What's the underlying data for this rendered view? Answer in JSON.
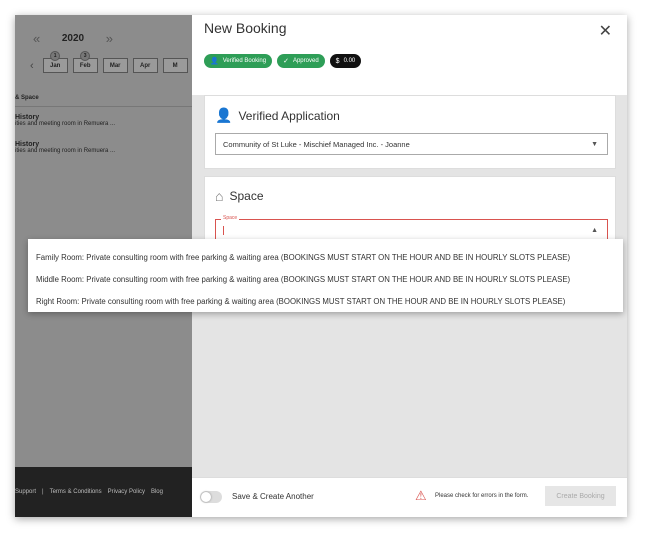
{
  "background": {
    "year": "2020",
    "prev_year_icon": "double-chevron-left-icon",
    "next_year_icon": "double-chevron-right-icon",
    "month_prev_icon": "chevron-left-icon",
    "months": [
      {
        "label": "Jan",
        "badge": "1"
      },
      {
        "label": "Feb",
        "badge": "3"
      },
      {
        "label": "Mar",
        "badge": ""
      },
      {
        "label": "Apr",
        "badge": ""
      },
      {
        "label": "M",
        "badge": ""
      }
    ],
    "space_header": "& Space",
    "history": [
      {
        "title": "History",
        "subtitle": "ities and meeting room in Remuera ..."
      },
      {
        "title": "History",
        "subtitle": "ities and meeting room in Remuera ..."
      }
    ],
    "footer_links": [
      "Support",
      "|",
      "Terms & Conditions",
      "Privacy Policy",
      "Blog"
    ]
  },
  "modal": {
    "title": "New Booking",
    "close_icon": "close-icon",
    "chips": [
      {
        "label": "Verified Booking",
        "icon": "user-check-icon",
        "color": "#2e9e57"
      },
      {
        "label": "Approved",
        "icon": "check-circle-icon",
        "color": "#2e9e57"
      },
      {
        "label": "0.00",
        "icon": "dollar-circle-icon",
        "color": "#111111"
      }
    ],
    "application_section": {
      "title": "Verified Application",
      "icon": "user-check-icon",
      "selected_value": "Community of St Luke - Mischief Managed Inc. - Joanne"
    },
    "space_section": {
      "title": "Space",
      "icon": "house-icon",
      "field_label": "Space",
      "value": ""
    },
    "footer": {
      "toggle_label": "Save & Create Another",
      "toggle_on": false,
      "error_text": "Please check for errors in the form.",
      "create_button": "Create Booking"
    }
  },
  "dropdown_options": [
    "Family Room: Private consulting room with free parking & waiting area (BOOKINGS MUST START ON THE HOUR AND BE IN HOURLY SLOTS PLEASE)",
    "Middle Room: Private consulting room with free parking & waiting area (BOOKINGS MUST START ON THE HOUR AND BE IN HOURLY SLOTS PLEASE)",
    "Right Room: Private consulting room with free parking & waiting area (BOOKINGS MUST START ON THE HOUR AND BE IN HOURLY SLOTS PLEASE)"
  ],
  "colors": {
    "accent_green": "#2e9e57",
    "error_red": "#d9534f",
    "overlay_gray": "#8c8c8c"
  }
}
